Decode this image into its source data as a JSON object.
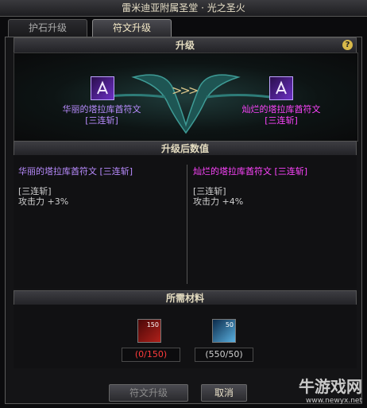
{
  "window": {
    "title": "雷米迪亚附属圣堂 · 光之圣火"
  },
  "tabs": [
    {
      "label": "护石升级",
      "active": false
    },
    {
      "label": "符文升级",
      "active": true
    }
  ],
  "upgrade": {
    "header": "升级",
    "help_glyph": "?",
    "from_rune": {
      "name_line1": "华丽的塔拉库酋符文",
      "name_line2": "[三连斩]",
      "color": "#b98cff"
    },
    "to_rune": {
      "name_line1": "灿烂的塔拉库酋符文",
      "name_line2": "[三连斩]",
      "color": "#ff44ff"
    },
    "arrow_glyph": ">>>"
  },
  "stats": {
    "header": "升级后数值",
    "left": {
      "title": "华丽的塔拉库酋符文 [三连斩]",
      "title_color": "#b98cff",
      "line1": "[三连斩]",
      "line2": "攻击力 +3%"
    },
    "right": {
      "title": "灿烂的塔拉库酋符文 [三连斩]",
      "title_color": "#ff44ff",
      "line1": "[三连斩]",
      "line2": "攻击力 +4%"
    }
  },
  "materials": {
    "header": "所需材料",
    "items": [
      {
        "icon": "red-crystal-icon",
        "badge": "150",
        "amount": "(0/150)",
        "amount_color": "#ff3b3b"
      },
      {
        "icon": "blue-crystal-icon",
        "badge": "50",
        "amount": "(550/50)",
        "amount_color": "#d0d0d0"
      }
    ]
  },
  "buttons": {
    "upgrade": "符文升级",
    "cancel": "取消"
  },
  "watermark": {
    "brand": "牛游戏网",
    "url": "www.newyx.net"
  }
}
